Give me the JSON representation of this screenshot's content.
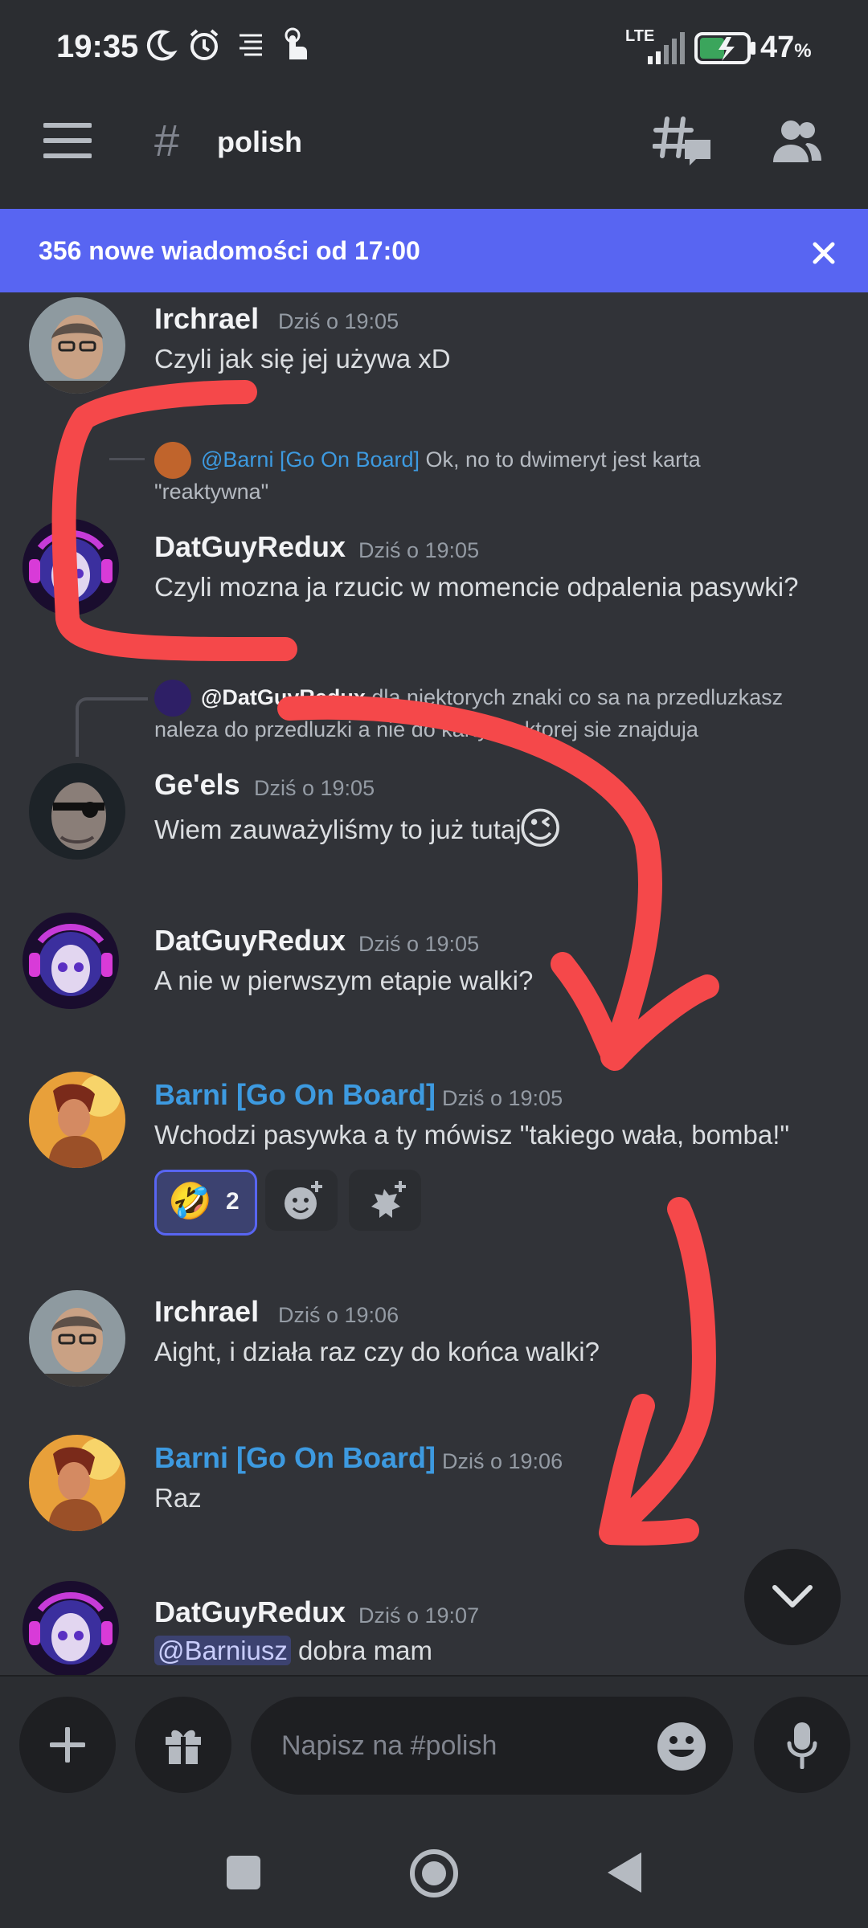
{
  "status_bar": {
    "time": "19:35",
    "icons": [
      "moon-icon",
      "alarm-icon",
      "notification-list-icon",
      "touch-icon"
    ],
    "network": "LTE",
    "battery": "47",
    "battery_unit": "%"
  },
  "header": {
    "menu_icon": "hamburger-menu-icon",
    "channel_prefix": "#",
    "channel_name": "polish",
    "threads_icon": "threads-icon",
    "members_icon": "members-icon"
  },
  "new_messages_banner": {
    "text": "356 nowe wiadomości od 17:00",
    "close_icon": "close-icon"
  },
  "messages": [
    {
      "author": "Irchrael",
      "timestamp": "Dziś o 19:05",
      "text": "Czyli jak się jej używa xD"
    },
    {
      "reply_to": "@Barni [Go On Board]",
      "reply_snippet_1": "Ok, no to dwimeryt jest karta",
      "reply_snippet_2": "\"reaktywna\"",
      "author": "DatGuyRedux",
      "timestamp": "Dziś o 19:05",
      "text": "Czyli mozna ja rzucic w momencie odpalenia pasywki?"
    },
    {
      "reply_to": "@DatGuyRedux",
      "reply_snippet_1": "dla niektorych znaki co sa na przedluzkasz",
      "reply_snippet_2": "naleza do przedluzki a nie do karty na ktorej sie znajduja",
      "author": "Ge'els",
      "timestamp": "Dziś o 19:05",
      "text": "Wiem zauważyliśmy to już tutaj",
      "emoji": "😉"
    },
    {
      "author": "DatGuyRedux",
      "timestamp": "Dziś o 19:05",
      "text": "A nie w pierwszym etapie walki?"
    },
    {
      "author": "Barni [Go On Board]",
      "timestamp": "Dziś o 19:05",
      "text": "Wchodzi pasywka a ty mówisz \"takiego wała, bomba!\"",
      "reactions": [
        {
          "emoji": "🤣",
          "count": "2"
        }
      ]
    },
    {
      "author": "Irchrael",
      "timestamp": "Dziś o 19:06",
      "text": "Aight, i działa raz czy do końca walki?"
    },
    {
      "author": "Barni [Go On Board]",
      "timestamp": "Dziś o 19:06",
      "text": "Raz"
    },
    {
      "author": "DatGuyRedux",
      "timestamp": "Dziś o 19:07",
      "mention": "@Barniusz",
      "text": " dobra mam"
    }
  ],
  "composer": {
    "placeholder": "Napisz na #polish"
  },
  "colors": {
    "background": "#313338",
    "header": "#2b2d31",
    "banner": "#5865f2",
    "role_blue": "#3d9ae0",
    "annotation_red": "#f5484a"
  }
}
